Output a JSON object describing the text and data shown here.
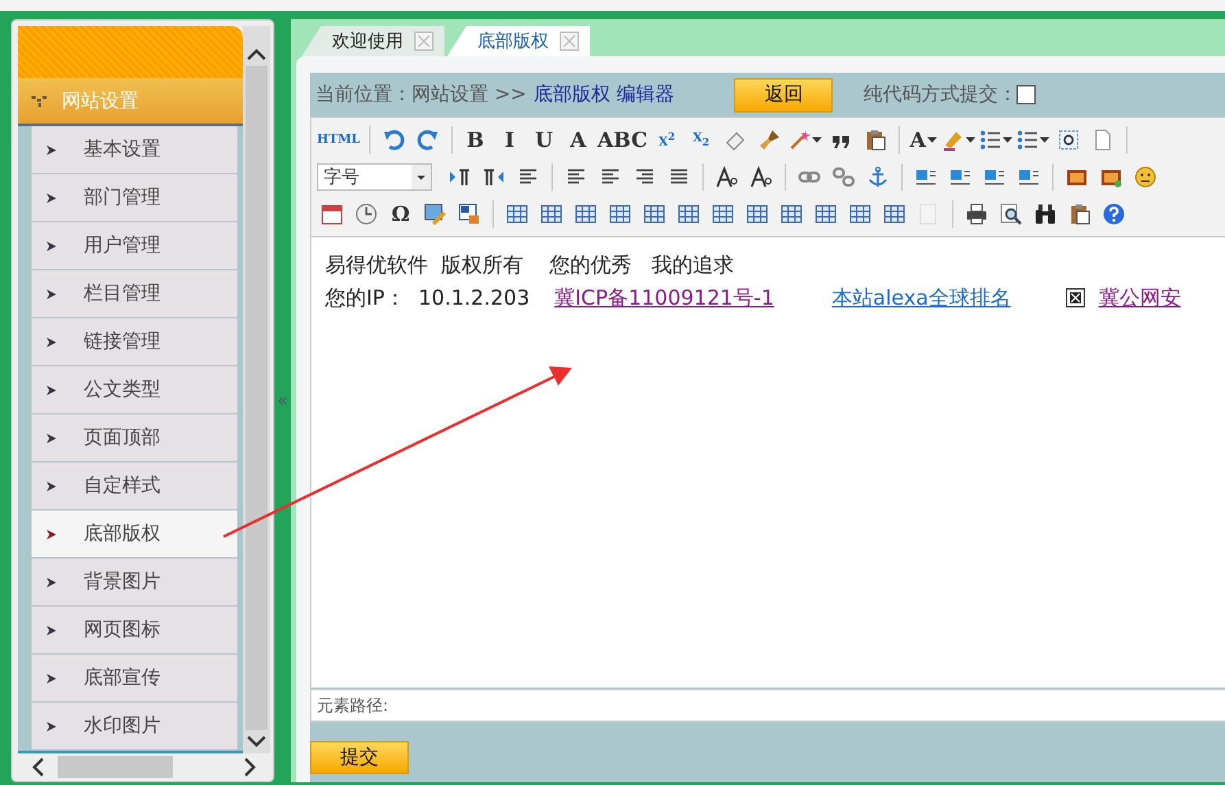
{
  "sidebar": {
    "section": "网站设置",
    "items": [
      {
        "label": "基本设置",
        "selected": false
      },
      {
        "label": "部门管理",
        "selected": false
      },
      {
        "label": "用户管理",
        "selected": false
      },
      {
        "label": "栏目管理",
        "selected": false
      },
      {
        "label": "链接管理",
        "selected": false
      },
      {
        "label": "公文类型",
        "selected": false
      },
      {
        "label": "页面顶部",
        "selected": false
      },
      {
        "label": "自定样式",
        "selected": false
      },
      {
        "label": "底部版权",
        "selected": true
      },
      {
        "label": "背景图片",
        "selected": false
      },
      {
        "label": "网页图标",
        "selected": false
      },
      {
        "label": "底部宣传",
        "selected": false
      },
      {
        "label": "水印图片",
        "selected": false
      }
    ]
  },
  "splitter": "«",
  "tabs": [
    {
      "label": "欢迎使用",
      "selected": false
    },
    {
      "label": "底部版权",
      "selected": true
    }
  ],
  "breadcrumb": {
    "prefix": "当前位置：网站设置 >>",
    "current": "底部版权 编辑器"
  },
  "back_button": "返回",
  "code_mode": {
    "label": "纯代码方式提交：",
    "checked": false
  },
  "toolbar": [
    [
      {
        "kind": "text",
        "label": "HTML"
      },
      {
        "kind": "sep"
      },
      {
        "kind": "icon"
      },
      {
        "kind": "icon"
      },
      {
        "kind": "sep"
      },
      {
        "kind": "text",
        "label": "B"
      },
      {
        "kind": "text",
        "label": "I"
      },
      {
        "kind": "text",
        "label": "U"
      },
      {
        "kind": "text",
        "label": "A"
      },
      {
        "kind": "text",
        "label": "ABC"
      },
      {
        "kind": "text",
        "label": "X$^{2}$"
      },
      {
        "kind": "text",
        "label": "X$_{2}$"
      },
      {
        "kind": "icon"
      },
      {
        "kind": "icon"
      },
      {
        "kind": "icon",
        "menu": true
      },
      {
        "kind": "icon"
      },
      {
        "kind": "icon"
      },
      {
        "kind": "sep"
      },
      {
        "kind": "text",
        "label": "A",
        "menu": true
      },
      {
        "kind": "icon",
        "menu": true
      },
      {
        "kind": "icon",
        "menu": true
      },
      {
        "kind": "icon",
        "menu": true
      },
      {
        "kind": "icon"
      },
      {
        "kind": "icon"
      },
      {
        "kind": "sep"
      }
    ],
    [
      {
        "kind": "select",
        "label": "字号"
      },
      {
        "kind": "icon"
      },
      {
        "kind": "icon"
      },
      {
        "kind": "icon"
      },
      {
        "kind": "sep"
      },
      {
        "kind": "icon"
      },
      {
        "kind": "icon"
      },
      {
        "kind": "icon"
      },
      {
        "kind": "icon"
      },
      {
        "kind": "sep"
      },
      {
        "kind": "icon"
      },
      {
        "kind": "icon"
      },
      {
        "kind": "sep"
      },
      {
        "kind": "icon"
      },
      {
        "kind": "icon"
      },
      {
        "kind": "icon"
      },
      {
        "kind": "sep"
      },
      {
        "kind": "icon"
      },
      {
        "kind": "icon"
      },
      {
        "kind": "icon"
      },
      {
        "kind": "icon"
      },
      {
        "kind": "sep"
      },
      {
        "kind": "icon"
      },
      {
        "kind": "icon"
      },
      {
        "kind": "icon"
      }
    ],
    [
      {
        "kind": "icon"
      },
      {
        "kind": "icon"
      },
      {
        "kind": "text",
        "label": "Ω"
      },
      {
        "kind": "icon"
      },
      {
        "kind": "icon"
      },
      {
        "kind": "sep"
      },
      {
        "kind": "icon"
      },
      {
        "kind": "icon"
      },
      {
        "kind": "icon"
      },
      {
        "kind": "icon"
      },
      {
        "kind": "icon"
      },
      {
        "kind": "icon"
      },
      {
        "kind": "icon"
      },
      {
        "kind": "icon"
      },
      {
        "kind": "icon"
      },
      {
        "kind": "icon"
      },
      {
        "kind": "icon"
      },
      {
        "kind": "icon"
      },
      {
        "kind": "icon"
      },
      {
        "kind": "sep"
      },
      {
        "kind": "icon"
      },
      {
        "kind": "icon"
      },
      {
        "kind": "icon"
      },
      {
        "kind": "icon"
      },
      {
        "kind": "icon"
      }
    ]
  ],
  "content": {
    "line_1": "易得优软件  版权所有    您的优秀   我的追求",
    "ip_label": "您的IP：  10.1.2.203",
    "links": [
      {
        "label": "冀ICP备11009121号-1",
        "visited": true
      },
      {
        "label": "本站alexa全球排名",
        "visited": false
      },
      {
        "label": "冀公网安",
        "visited": true
      }
    ]
  },
  "element_path": "元素路径:",
  "submit_button": "提交"
}
